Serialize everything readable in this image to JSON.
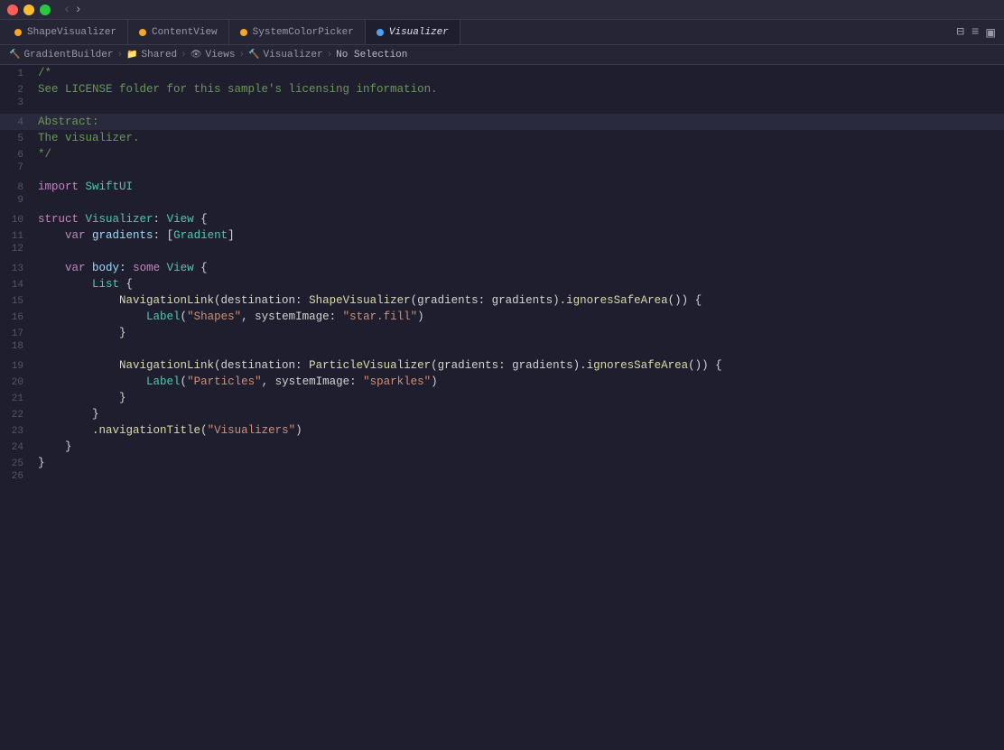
{
  "titlebar": {
    "grid_icon": "⊞",
    "nav_back": "‹",
    "nav_forward": "›"
  },
  "tabs": [
    {
      "id": "shapevisualizer",
      "label": "ShapeVisualizer",
      "dot_color": "dot-shape",
      "active": false
    },
    {
      "id": "contentview",
      "label": "ContentView",
      "dot_color": "dot-content",
      "active": false
    },
    {
      "id": "systemcolorpicker",
      "label": "SystemColorPicker",
      "dot_color": "dot-color",
      "active": false
    },
    {
      "id": "visualizer",
      "label": "Visualizer",
      "dot_color": "dot-visualizer",
      "active": true
    }
  ],
  "toolbar_right": {
    "split_icon": "⊟",
    "list_icon": "≡",
    "inspector_icon": "▣"
  },
  "breadcrumb": {
    "items": [
      {
        "label": "GradientBuilder",
        "icon": "🔨"
      },
      {
        "label": "Shared",
        "icon": "📁"
      },
      {
        "label": "Views",
        "icon": "👁"
      },
      {
        "label": "Visualizer",
        "icon": "🔨"
      },
      {
        "label": "No Selection",
        "icon": ""
      }
    ]
  },
  "code": {
    "lines": [
      {
        "num": 1,
        "highlighted": false,
        "html": "<span class='c-comment'>/*</span>"
      },
      {
        "num": 2,
        "highlighted": false,
        "html": "<span class='c-comment'>See LICENSE folder for this sample's licensing information.</span>"
      },
      {
        "num": 3,
        "highlighted": false,
        "html": ""
      },
      {
        "num": 4,
        "highlighted": true,
        "html": "<span class='c-comment'>Abstract:</span>"
      },
      {
        "num": 5,
        "highlighted": false,
        "html": "<span class='c-comment'>The visualizer.</span>"
      },
      {
        "num": 6,
        "highlighted": false,
        "html": "<span class='c-comment'>*/</span>"
      },
      {
        "num": 7,
        "highlighted": false,
        "html": ""
      },
      {
        "num": 8,
        "highlighted": false,
        "html": "<span class='c-import'>import</span> <span class='c-framework'>SwiftUI</span>"
      },
      {
        "num": 9,
        "highlighted": false,
        "html": ""
      },
      {
        "num": 10,
        "highlighted": false,
        "html": "<span class='c-struct'>struct</span> <span class='c-type'>Visualizer</span><span class='c-white'>: </span><span class='c-type'>View</span> <span class='c-white'>{</span>"
      },
      {
        "num": 11,
        "highlighted": false,
        "html": "    <span class='c-var'>var</span> <span class='c-blue'>gradients</span><span class='c-white'>: [</span><span class='c-type'>Gradient</span><span class='c-white'>]</span>"
      },
      {
        "num": 12,
        "highlighted": false,
        "html": ""
      },
      {
        "num": 13,
        "highlighted": false,
        "html": "    <span class='c-var'>var</span> <span class='c-blue'>body</span><span class='c-white'>: </span><span class='c-var'>some</span> <span class='c-type'>View</span> <span class='c-white'>{</span>"
      },
      {
        "num": 14,
        "highlighted": false,
        "html": "        <span class='c-type'>List</span> <span class='c-white'>{</span>"
      },
      {
        "num": 15,
        "highlighted": false,
        "html": "            <span class='c-nav'>NavigationLink</span><span class='c-white'>(destination: </span><span class='c-funcname'>ShapeVisualizer</span><span class='c-white'>(gradients: gradients).</span><span class='c-method'>ignoresSafeArea</span><span class='c-white'>()) {</span>"
      },
      {
        "num": 16,
        "highlighted": false,
        "html": "                <span class='c-type'>Label</span><span class='c-white'>(</span><span class='c-string'>\"Shapes\"</span><span class='c-white'>, systemImage: </span><span class='c-string'>\"star.fill\"</span><span class='c-white'>)</span>"
      },
      {
        "num": 17,
        "highlighted": false,
        "html": "            <span class='c-white'>}</span>"
      },
      {
        "num": 18,
        "highlighted": false,
        "html": ""
      },
      {
        "num": 19,
        "highlighted": false,
        "html": "            <span class='c-nav'>NavigationLink</span><span class='c-white'>(destination: </span><span class='c-funcname'>ParticleVisualizer</span><span class='c-white'>(gradients: gradients).</span><span class='c-method'>ignoresSafeArea</span><span class='c-white'>()) {</span>"
      },
      {
        "num": 20,
        "highlighted": false,
        "html": "                <span class='c-type'>Label</span><span class='c-white'>(</span><span class='c-string'>\"Particles\"</span><span class='c-white'>, systemImage: </span><span class='c-string'>\"sparkles\"</span><span class='c-white'>)</span>"
      },
      {
        "num": 21,
        "highlighted": false,
        "html": "            <span class='c-white'>}</span>"
      },
      {
        "num": 22,
        "highlighted": false,
        "html": "        <span class='c-white'>}</span>"
      },
      {
        "num": 23,
        "highlighted": false,
        "html": "        <span class='c-white'>.</span><span class='c-method'>navigationTitle</span><span class='c-white'>(</span><span class='c-string'>\"Visualizers\"</span><span class='c-white'>)</span>"
      },
      {
        "num": 24,
        "highlighted": false,
        "html": "    <span class='c-white'>}</span>"
      },
      {
        "num": 25,
        "highlighted": false,
        "html": "<span class='c-white'>}</span>"
      },
      {
        "num": 26,
        "highlighted": false,
        "html": ""
      }
    ]
  }
}
